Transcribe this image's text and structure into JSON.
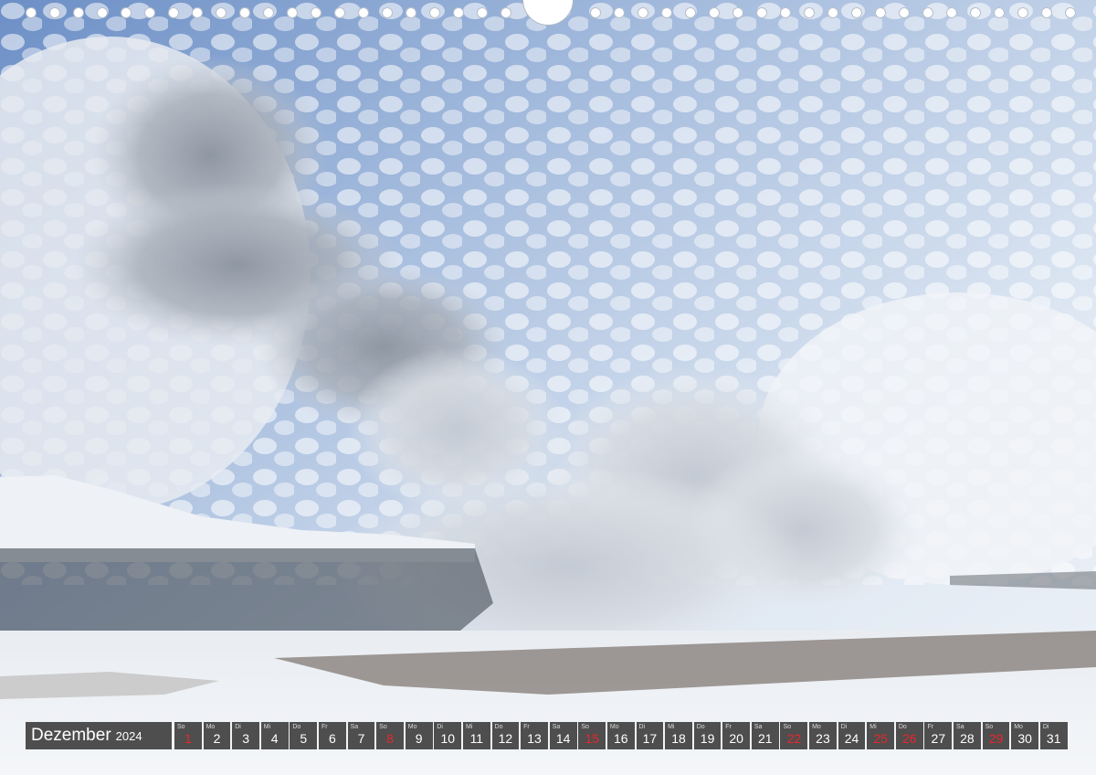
{
  "calendar": {
    "month": "Dezember",
    "year": "2024",
    "days": [
      {
        "wd": "So",
        "num": "1",
        "red": true
      },
      {
        "wd": "Mo",
        "num": "2",
        "red": false
      },
      {
        "wd": "Di",
        "num": "3",
        "red": false
      },
      {
        "wd": "Mi",
        "num": "4",
        "red": false
      },
      {
        "wd": "Do",
        "num": "5",
        "red": false
      },
      {
        "wd": "Fr",
        "num": "6",
        "red": false
      },
      {
        "wd": "Sa",
        "num": "7",
        "red": false
      },
      {
        "wd": "So",
        "num": "8",
        "red": true
      },
      {
        "wd": "Mo",
        "num": "9",
        "red": false
      },
      {
        "wd": "Di",
        "num": "10",
        "red": false
      },
      {
        "wd": "Mi",
        "num": "11",
        "red": false
      },
      {
        "wd": "Do",
        "num": "12",
        "red": false
      },
      {
        "wd": "Fr",
        "num": "13",
        "red": false
      },
      {
        "wd": "Sa",
        "num": "14",
        "red": false
      },
      {
        "wd": "So",
        "num": "15",
        "red": true
      },
      {
        "wd": "Mo",
        "num": "16",
        "red": false
      },
      {
        "wd": "Di",
        "num": "17",
        "red": false
      },
      {
        "wd": "Mi",
        "num": "18",
        "red": false
      },
      {
        "wd": "Do",
        "num": "19",
        "red": false
      },
      {
        "wd": "Fr",
        "num": "20",
        "red": false
      },
      {
        "wd": "Sa",
        "num": "21",
        "red": false
      },
      {
        "wd": "So",
        "num": "22",
        "red": true
      },
      {
        "wd": "Mo",
        "num": "23",
        "red": false
      },
      {
        "wd": "Di",
        "num": "24",
        "red": false
      },
      {
        "wd": "Mi",
        "num": "25",
        "red": true
      },
      {
        "wd": "Do",
        "num": "26",
        "red": true
      },
      {
        "wd": "Fr",
        "num": "27",
        "red": false
      },
      {
        "wd": "Sa",
        "num": "28",
        "red": false
      },
      {
        "wd": "So",
        "num": "29",
        "red": true
      },
      {
        "wd": "Mo",
        "num": "30",
        "red": false
      },
      {
        "wd": "Di",
        "num": "31",
        "red": false
      }
    ]
  },
  "colors": {
    "holiday_red": "#e8262a",
    "bar_bg": "#373737",
    "sky_blue": "#4f74b3"
  },
  "icons": {
    "binding": "spiral-binding-holes"
  }
}
